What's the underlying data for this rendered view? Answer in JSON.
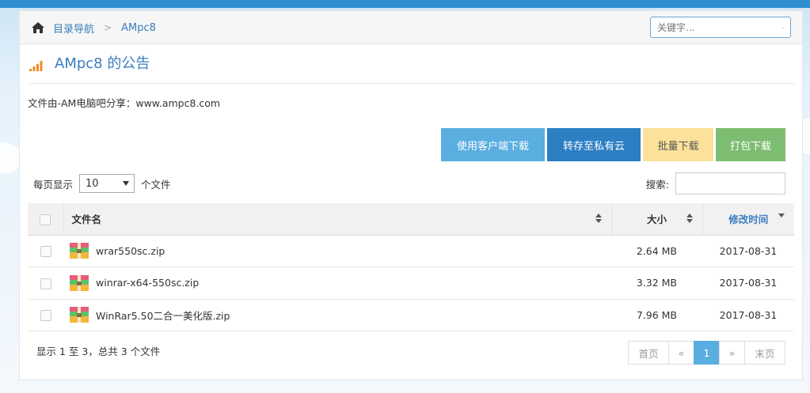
{
  "breadcrumb": {
    "home_icon": "home-icon",
    "root": "目录导航",
    "separator": ">",
    "current": "AMpc8"
  },
  "search": {
    "placeholder": "关键字..."
  },
  "title": "AMpc8 的公告",
  "notice": "文件由-AM电脑吧分享：www.ampc8.com",
  "actions": {
    "client_download": "使用客户端下载",
    "save_to_cloud": "转存至私有云",
    "batch_download": "批量下载",
    "pack_download": "打包下载"
  },
  "colors": {
    "btn_client": "#5aaee0",
    "btn_cloud": "#2d7fc3",
    "btn_batch": "#fbe19a",
    "btn_pack": "#7dbd71",
    "link": "#3b7dc0"
  },
  "length": {
    "prefix": "每页显示",
    "value": "10",
    "suffix": "个文件"
  },
  "filter": {
    "label": "搜索:"
  },
  "table": {
    "headers": {
      "name": "文件名",
      "size": "大小",
      "date": "修改时间"
    },
    "rows": [
      {
        "name": "wrar550sc.zip",
        "size": "2.64 MB",
        "date": "2017-08-31"
      },
      {
        "name": "winrar-x64-550sc.zip",
        "size": "3.32 MB",
        "date": "2017-08-31"
      },
      {
        "name": "WinRar5.50二合一美化版.zip",
        "size": "7.96 MB",
        "date": "2017-08-31"
      }
    ]
  },
  "info": "显示 1 至 3，总共 3 个文件",
  "pagination": {
    "first": "首页",
    "prev": "«",
    "page": "1",
    "next": "»",
    "last": "末页"
  }
}
